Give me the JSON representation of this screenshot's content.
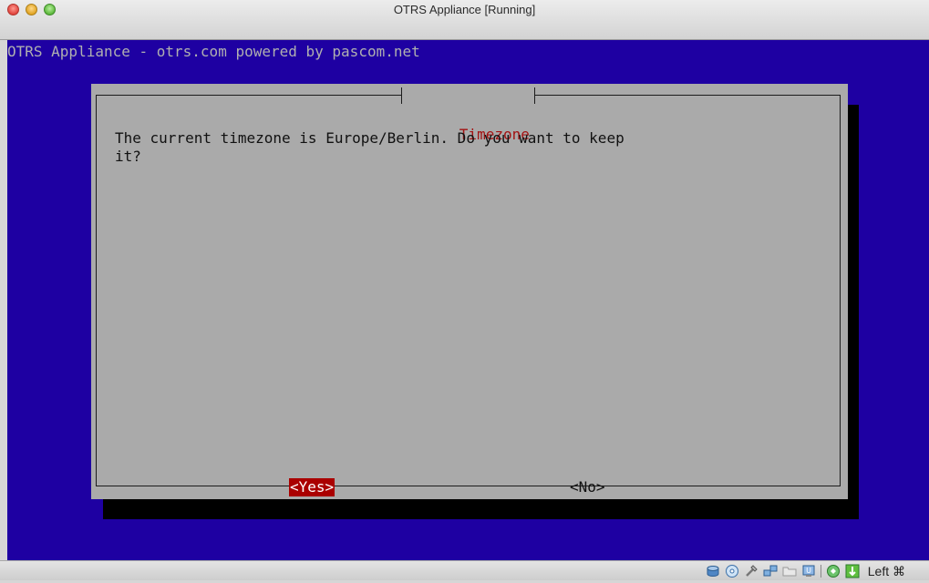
{
  "window": {
    "title": "OTRS Appliance [Running]"
  },
  "console": {
    "backtitle": "OTRS Appliance - otrs.com powered by pascom.net",
    "dialog": {
      "title": "Timezone",
      "message": "The current timezone is Europe/Berlin. Do you want to keep\nit?",
      "buttons": {
        "yes": "<Yes>",
        "no": "<No>"
      },
      "selected_button": "yes"
    }
  },
  "statusbar": {
    "icons": [
      "hard-disk-icon",
      "optical-disk-icon",
      "usb-icon",
      "network-icon",
      "shared-folder-icon",
      "display-icon",
      "cpu-virtualization-icon",
      "mouse-integration-icon"
    ],
    "host_key": "Left ⌘"
  },
  "colors": {
    "console_background": "#1e00a2",
    "dialog_background": "#aaaaaa",
    "dialog_title": "#a31212",
    "selected_button_bg": "#aa0000"
  }
}
